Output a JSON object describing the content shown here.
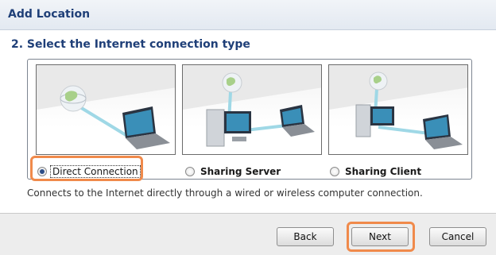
{
  "window": {
    "title": "Add Location"
  },
  "step": {
    "heading": "2. Select the Internet connection type"
  },
  "options": [
    {
      "label": "Direct Connection",
      "selected": true
    },
    {
      "label": "Sharing Server",
      "selected": false
    },
    {
      "label": "Sharing Client",
      "selected": false
    }
  ],
  "description": "Connects to the Internet directly through a wired or wireless computer connection.",
  "buttons": {
    "back": "Back",
    "next": "Next",
    "cancel": "Cancel"
  },
  "colors": {
    "accent": "#1f3f78",
    "highlight": "#f08a4b"
  }
}
